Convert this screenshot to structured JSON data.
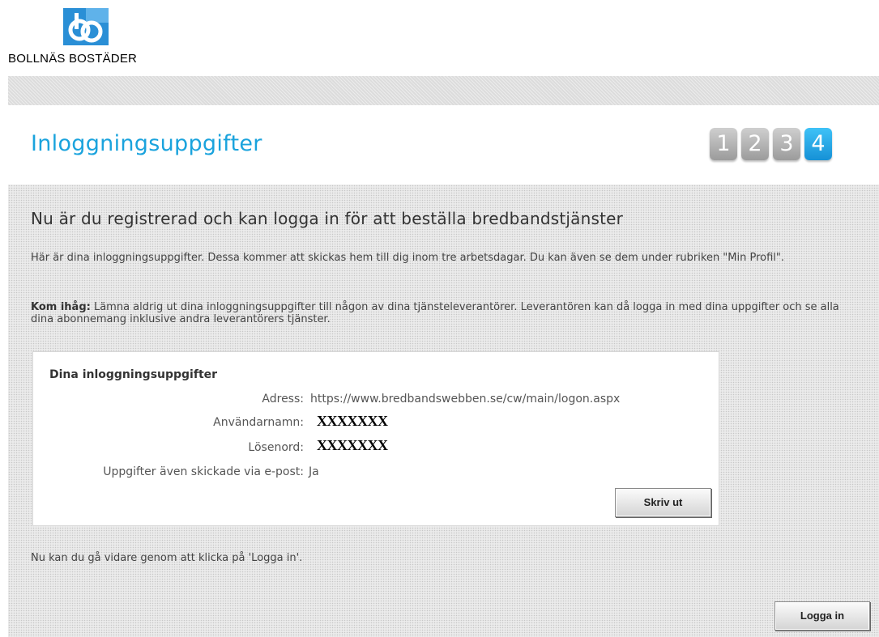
{
  "header": {
    "logo_icon": "bollnas-bostader-logo",
    "brand_name": "BOLLNÄS BOSTÄDER"
  },
  "page": {
    "title": "Inloggningsuppgifter",
    "steps": [
      "1",
      "2",
      "3",
      "4"
    ],
    "active_step": 4
  },
  "content": {
    "headline": "Nu är du registrerad och kan logga in för att beställa bredbandstjänster",
    "paragraph1": "Här är dina inloggningsuppgifter. Dessa kommer att skickas hem till dig inom tre arbetsdagar. Du kan även se dem under rubriken \"Min Profil\".",
    "paragraph2_bold": "Kom ihåg:",
    "paragraph2_text": " Lämna aldrig ut dina inloggningsuppgifter till någon av dina tjänsteleverantörer. Leverantören kan då logga in med dina uppgifter och se alla dina abonnemang inklusive andra leverantörers tjänster.",
    "footer_note": "Nu kan du gå vidare genom att klicka på 'Logga in'."
  },
  "credentials": {
    "title": "Dina inloggningsuppgifter",
    "address_label": "Adress:",
    "address_value": "https://www.bredbandswebben.se/cw/main/logon.aspx",
    "username_label": "Användarnamn:",
    "username_value": "XXXXXXX",
    "password_label": "Lösenord:",
    "password_value": "XXXXXXX",
    "email_label": "Uppgifter även skickade via e-post:",
    "email_value": "Ja",
    "print_button": "Skriv ut"
  },
  "actions": {
    "login_button": "Logga in"
  },
  "colors": {
    "title_blue": "#1aa3dd",
    "step_active": "#1691d6",
    "step_inactive": "#9b9b9b"
  }
}
